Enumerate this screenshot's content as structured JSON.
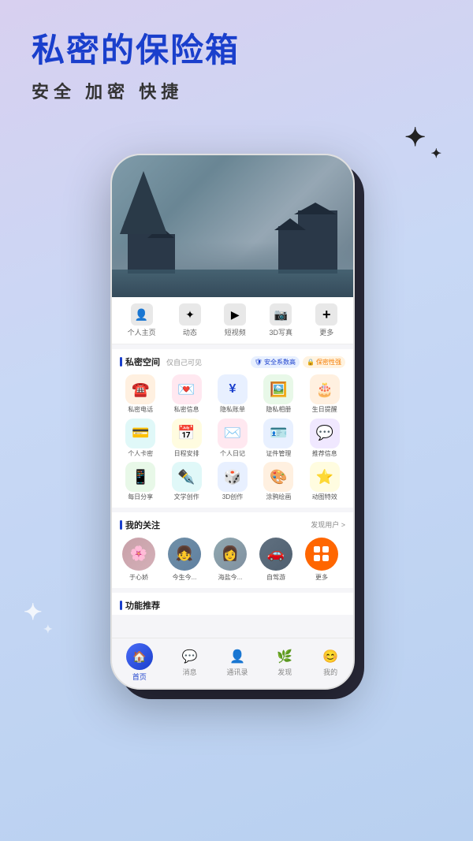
{
  "header": {
    "main_title": "私密的保险箱",
    "sub_title": "安全   加密   快捷"
  },
  "phone": {
    "nav_items": [
      {
        "label": "个人主页",
        "icon": "👤"
      },
      {
        "label": "动态",
        "icon": "✦"
      },
      {
        "label": "短视频",
        "icon": "▶"
      },
      {
        "label": "3D写真",
        "icon": "📷"
      },
      {
        "label": "更多",
        "icon": "+"
      }
    ],
    "private_space": {
      "title": "私密空间",
      "subtitle": "仅自己可见",
      "badge_security": "安全系数高",
      "badge_privacy": "保密性强",
      "icons": [
        {
          "label": "私密电话",
          "emoji": "☎",
          "color": "ic-orange"
        },
        {
          "label": "私密信息",
          "emoji": "💌",
          "color": "ic-pink"
        },
        {
          "label": "隐私账单",
          "emoji": "¥",
          "color": "ic-blue"
        },
        {
          "label": "隐私相册",
          "emoji": "🖼",
          "color": "ic-green"
        },
        {
          "label": "生日提醒",
          "emoji": "🎂",
          "color": "ic-orange"
        },
        {
          "label": "个人卡密",
          "emoji": "💳",
          "color": "ic-teal"
        },
        {
          "label": "日程安排",
          "emoji": "📅",
          "color": "ic-yellow"
        },
        {
          "label": "个人日记",
          "emoji": "✉",
          "color": "ic-pink"
        },
        {
          "label": "证件管理",
          "emoji": "🪪",
          "color": "ic-blue"
        },
        {
          "label": "推荐信息",
          "emoji": "💬",
          "color": "ic-purple"
        },
        {
          "label": "每日分享",
          "emoji": "📱",
          "color": "ic-green"
        },
        {
          "label": "文学创作",
          "emoji": "✒",
          "color": "ic-teal"
        },
        {
          "label": "3D创作",
          "emoji": "🎲",
          "color": "ic-blue"
        },
        {
          "label": "涂鸦绘画",
          "emoji": "🎨",
          "color": "ic-orange"
        },
        {
          "label": "动图特效",
          "emoji": "⭐",
          "color": "ic-yellow"
        }
      ]
    },
    "follows": {
      "title": "我的关注",
      "link": "发现用户 >",
      "items": [
        {
          "name": "于心娇",
          "color": "av1"
        },
        {
          "name": "今生今...",
          "color": "av2"
        },
        {
          "name": "海盐今...",
          "color": "av3"
        },
        {
          "name": "自驾游",
          "color": "av4"
        },
        {
          "name": "更多",
          "color": "more"
        }
      ]
    },
    "features": {
      "title": "功能推荐"
    },
    "bottom_tabs": [
      {
        "label": "首页",
        "icon": "🏠",
        "active": true
      },
      {
        "label": "消息",
        "icon": "💬"
      },
      {
        "label": "通讯录",
        "icon": "👤"
      },
      {
        "label": "发现",
        "icon": "🌿"
      },
      {
        "label": "我的",
        "icon": "😊"
      }
    ]
  }
}
